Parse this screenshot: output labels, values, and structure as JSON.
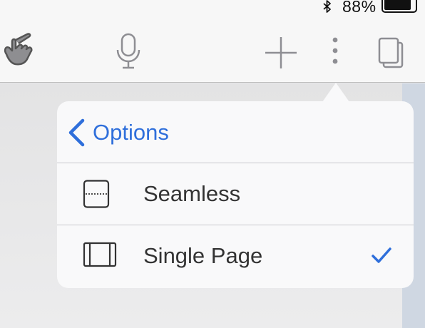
{
  "status_bar": {
    "bluetooth_icon": "bluetooth-icon",
    "battery_percent": "88%",
    "battery_level": 0.88
  },
  "toolbar": {
    "buttons": [
      {
        "name": "hand-tool",
        "icon": "pointing-hand-icon"
      },
      {
        "name": "dictation",
        "icon": "microphone-icon"
      },
      {
        "name": "add",
        "icon": "plus-icon"
      },
      {
        "name": "more",
        "icon": "vertical-ellipsis-icon"
      },
      {
        "name": "tabs",
        "icon": "pages-icon"
      }
    ]
  },
  "popover": {
    "back_label": "Options",
    "back_icon": "chevron-left-icon",
    "accent_color": "#2f6fdb",
    "options": [
      {
        "label": "Seamless",
        "icon": "seamless-page-icon",
        "selected": false
      },
      {
        "label": "Single Page",
        "icon": "single-page-icon",
        "selected": true
      }
    ]
  }
}
